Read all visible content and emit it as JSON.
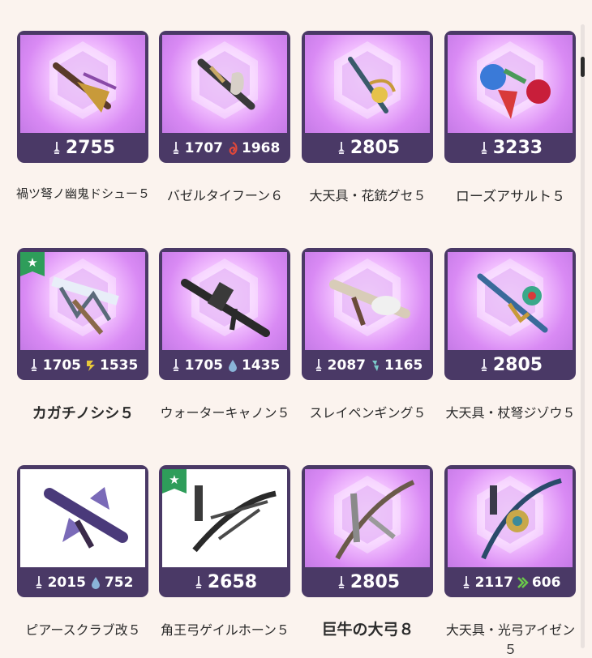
{
  "cards": [
    {
      "name": "禍ツ弩ノ幽鬼ドシュー５",
      "stats": [
        {
          "icon": "attack-icon",
          "value": "2755"
        }
      ],
      "favorite": false
    },
    {
      "name": "バゼルタイフーン６",
      "stats": [
        {
          "icon": "attack-icon",
          "value": "1707"
        },
        {
          "icon": "blast-icon",
          "value": "1968"
        }
      ],
      "favorite": false
    },
    {
      "name": "大天具・花銃グセ５",
      "stats": [
        {
          "icon": "attack-icon",
          "value": "2805"
        }
      ],
      "favorite": false
    },
    {
      "name": "ローズアサルト５",
      "stats": [
        {
          "icon": "attack-icon",
          "value": "3233"
        }
      ],
      "favorite": false
    },
    {
      "name": "カガチノシシ５",
      "stats": [
        {
          "icon": "attack-icon",
          "value": "1705"
        },
        {
          "icon": "thunder-icon",
          "value": "1535"
        }
      ],
      "favorite": true
    },
    {
      "name": "ウォーターキャノン５",
      "stats": [
        {
          "icon": "attack-icon",
          "value": "1705"
        },
        {
          "icon": "water-icon",
          "value": "1435"
        }
      ],
      "favorite": false
    },
    {
      "name": "スレイペンギング５",
      "stats": [
        {
          "icon": "attack-icon",
          "value": "2087"
        },
        {
          "icon": "ice-icon",
          "value": "1165"
        }
      ],
      "favorite": false
    },
    {
      "name": "大天具・杖弩ジゾウ５",
      "stats": [
        {
          "icon": "attack-icon",
          "value": "2805"
        }
      ],
      "favorite": false
    },
    {
      "name": "ピアースクラブ改５",
      "stats": [
        {
          "icon": "attack-icon",
          "value": "2015"
        },
        {
          "icon": "water-icon",
          "value": "752"
        }
      ],
      "favorite": false
    },
    {
      "name": "角王弓ゲイルホーン５",
      "stats": [
        {
          "icon": "attack-icon",
          "value": "2658"
        }
      ],
      "favorite": true
    },
    {
      "name": "巨牛の大弓８",
      "stats": [
        {
          "icon": "attack-icon",
          "value": "2805"
        }
      ],
      "favorite": false
    },
    {
      "name": "大天具・光弓アイゼン５",
      "stats": [
        {
          "icon": "attack-icon",
          "value": "2117"
        },
        {
          "icon": "dragon-icon",
          "value": "606"
        }
      ],
      "favorite": false
    }
  ],
  "favorite_badge": "★",
  "colors": {
    "card": "#4a3966",
    "background": "#fbf3ee",
    "favorite": "#2e9d5a"
  }
}
